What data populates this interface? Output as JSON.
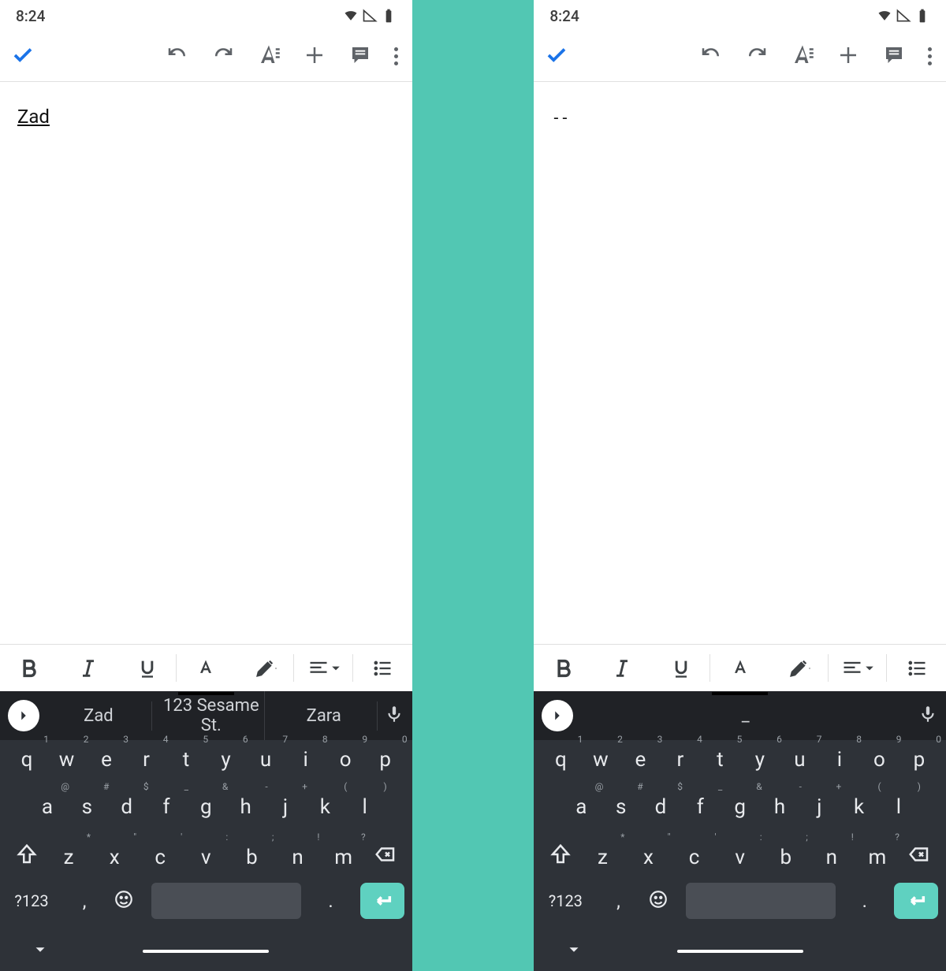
{
  "status": {
    "time": "8:24"
  },
  "appbar": {
    "icons": [
      "check",
      "undo",
      "redo",
      "format",
      "plus",
      "comment",
      "more"
    ]
  },
  "left": {
    "doc_text": "Zad",
    "suggestions": [
      "Zad",
      "123 Sesame St.",
      "Zara"
    ]
  },
  "right": {
    "doc_text": "--",
    "suggestions": [
      "_"
    ]
  },
  "keyboard": {
    "row1": [
      {
        "k": "q",
        "h": "1"
      },
      {
        "k": "w",
        "h": "2"
      },
      {
        "k": "e",
        "h": "3"
      },
      {
        "k": "r",
        "h": "4"
      },
      {
        "k": "t",
        "h": "5"
      },
      {
        "k": "y",
        "h": "6"
      },
      {
        "k": "u",
        "h": "7"
      },
      {
        "k": "i",
        "h": "8"
      },
      {
        "k": "o",
        "h": "9"
      },
      {
        "k": "p",
        "h": "0"
      }
    ],
    "row2": [
      {
        "k": "a",
        "h": "@"
      },
      {
        "k": "s",
        "h": "#"
      },
      {
        "k": "d",
        "h": "$"
      },
      {
        "k": "f",
        "h": "_"
      },
      {
        "k": "g",
        "h": "&"
      },
      {
        "k": "h",
        "h": "-"
      },
      {
        "k": "j",
        "h": "+"
      },
      {
        "k": "k",
        "h": "("
      },
      {
        "k": "l",
        "h": ")"
      }
    ],
    "row3": [
      {
        "k": "z",
        "h": "*"
      },
      {
        "k": "x",
        "h": "\""
      },
      {
        "k": "c",
        "h": "'"
      },
      {
        "k": "v",
        "h": ":"
      },
      {
        "k": "b",
        "h": ";"
      },
      {
        "k": "n",
        "h": "!"
      },
      {
        "k": "m",
        "h": "?"
      }
    ],
    "sym": "?123",
    "comma": ",",
    "period": "."
  }
}
